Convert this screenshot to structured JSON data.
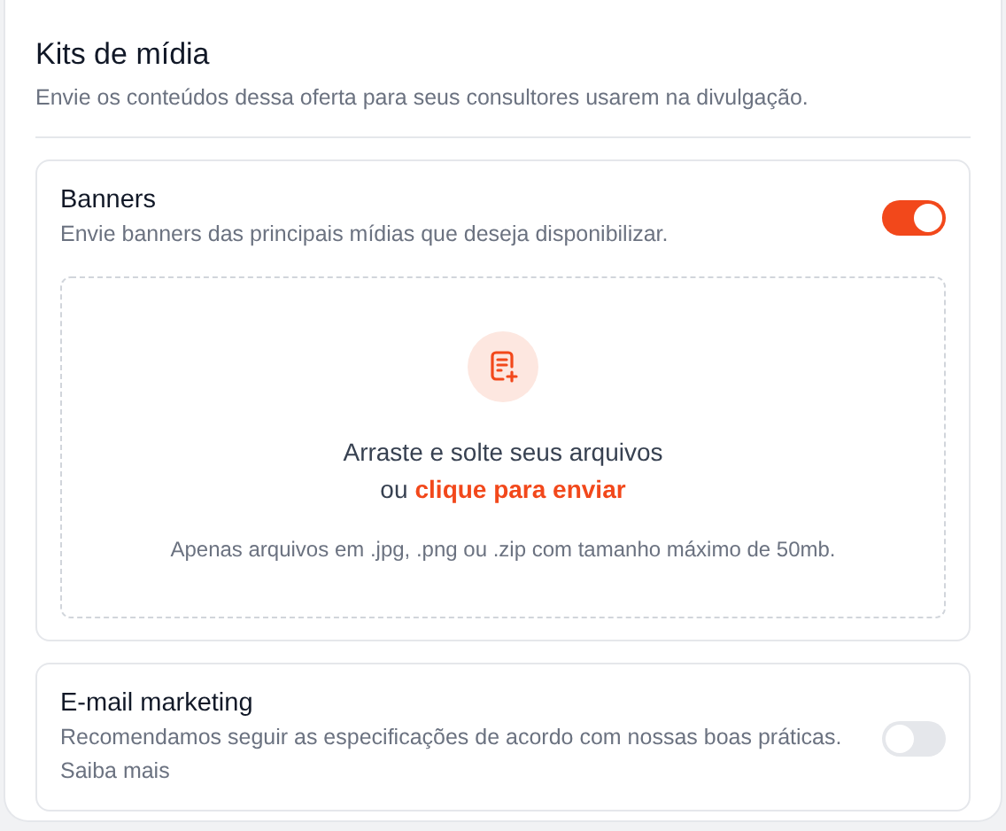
{
  "title": "Kits de mídia",
  "subtitle": "Envie os conteúdos dessa oferta para seus consultores usarem na divulgação.",
  "sections": [
    {
      "kind": "upload",
      "title": "Banners",
      "description": "Envie banners das principais mídias que deseja disponibilizar.",
      "on": true,
      "dropzone": {
        "line1": "Arraste e solte seus arquivos",
        "prefix": "ou",
        "link": "clique para enviar",
        "hint": "Apenas arquivos em .jpg, .png ou .zip com tamanho máximo de 50mb."
      }
    },
    {
      "kind": "plain",
      "title": "E-mail marketing",
      "description": "Recomendamos seguir as especificações de acordo com nossas boas práticas.",
      "more": "Saiba mais",
      "on": false
    }
  ]
}
